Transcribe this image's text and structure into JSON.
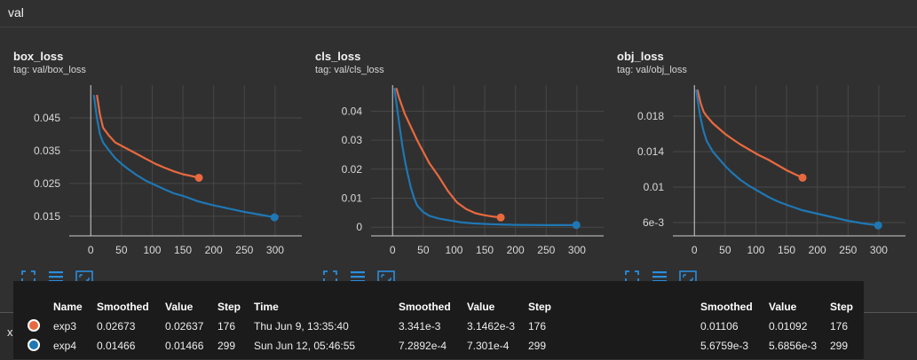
{
  "section": {
    "title": "val"
  },
  "lower_group_label": "x",
  "colors": {
    "exp3": "#e8693f",
    "exp4": "#1f77b4",
    "grid": "#474747",
    "axis": "#cccccc",
    "card_bg": "#303030"
  },
  "charts": [
    {
      "title": "box_loss",
      "tag": "tag: val/box_loss",
      "xlim": [
        -35,
        355
      ],
      "ylim": [
        0.009,
        0.055
      ],
      "yticks": [
        0.015,
        0.025,
        0.035,
        0.045
      ],
      "ytick_labels": [
        "0.015",
        "0.025",
        "0.035",
        "0.045"
      ],
      "xticks": [
        0,
        50,
        100,
        150,
        200,
        250,
        300
      ],
      "xtick_labels": [
        "0",
        "50",
        "100",
        "150",
        "200",
        "250",
        "300"
      ]
    },
    {
      "title": "cls_loss",
      "tag": "tag: val/cls_loss",
      "xlim": [
        -35,
        355
      ],
      "ylim": [
        -0.003,
        0.049
      ],
      "yticks": [
        0,
        0.01,
        0.02,
        0.03,
        0.04
      ],
      "ytick_labels": [
        "0",
        "0.01",
        "0.02",
        "0.03",
        "0.04"
      ],
      "xticks": [
        0,
        50,
        100,
        150,
        200,
        250,
        300
      ],
      "xtick_labels": [
        "0",
        "50",
        "100",
        "150",
        "200",
        "250",
        "300"
      ]
    },
    {
      "title": "obj_loss",
      "tag": "tag: val/obj_loss",
      "xlim": [
        -35,
        355
      ],
      "ylim": [
        0.0045,
        0.0215
      ],
      "yticks": [
        0.006,
        0.01,
        0.014,
        0.018
      ],
      "ytick_labels": [
        "6e-3",
        "0.01",
        "0.014",
        "0.018"
      ],
      "xticks": [
        0,
        50,
        100,
        150,
        200,
        250,
        300
      ],
      "xtick_labels": [
        "0",
        "50",
        "100",
        "150",
        "200",
        "250",
        "300"
      ]
    }
  ],
  "chart_data": [
    {
      "type": "line",
      "title": "box_loss",
      "series": [
        {
          "name": "exp3",
          "x": [
            10,
            15,
            20,
            30,
            40,
            50,
            60,
            75,
            90,
            105,
            120,
            135,
            150,
            165,
            176
          ],
          "y": [
            0.052,
            0.046,
            0.042,
            0.0395,
            0.0375,
            0.0365,
            0.0355,
            0.034,
            0.0325,
            0.031,
            0.0298,
            0.0287,
            0.0278,
            0.0272,
            0.02673
          ]
        },
        {
          "name": "exp4",
          "x": [
            5,
            10,
            15,
            20,
            30,
            40,
            50,
            60,
            75,
            90,
            105,
            120,
            135,
            150,
            175,
            200,
            225,
            250,
            275,
            299
          ],
          "y": [
            0.052,
            0.045,
            0.04,
            0.0375,
            0.035,
            0.0327,
            0.031,
            0.0295,
            0.0275,
            0.0258,
            0.0245,
            0.0232,
            0.022,
            0.0212,
            0.0195,
            0.0183,
            0.0173,
            0.0163,
            0.0155,
            0.01466
          ]
        }
      ]
    },
    {
      "type": "line",
      "title": "cls_loss",
      "series": [
        {
          "name": "exp3",
          "x": [
            6,
            10,
            15,
            20,
            30,
            40,
            50,
            60,
            75,
            90,
            105,
            120,
            135,
            150,
            165,
            176
          ],
          "y": [
            0.048,
            0.045,
            0.042,
            0.039,
            0.0345,
            0.03,
            0.026,
            0.022,
            0.0175,
            0.0125,
            0.0085,
            0.0062,
            0.0048,
            0.0041,
            0.0036,
            0.003341
          ]
        },
        {
          "name": "exp4",
          "x": [
            3,
            8,
            12,
            16,
            20,
            25,
            30,
            35,
            40,
            50,
            60,
            75,
            90,
            110,
            130,
            160,
            200,
            250,
            299
          ],
          "y": [
            0.048,
            0.04,
            0.034,
            0.028,
            0.023,
            0.018,
            0.0135,
            0.01,
            0.0075,
            0.0052,
            0.0039,
            0.003,
            0.0024,
            0.0017,
            0.0013,
            0.001,
            0.0008,
            0.0007,
            0.00072892
          ]
        }
      ]
    },
    {
      "type": "line",
      "title": "obj_loss",
      "series": [
        {
          "name": "exp3",
          "x": [
            5,
            10,
            15,
            20,
            30,
            40,
            50,
            60,
            75,
            90,
            105,
            120,
            135,
            150,
            165,
            176
          ],
          "y": [
            0.021,
            0.0195,
            0.0185,
            0.018,
            0.0172,
            0.0166,
            0.016,
            0.0155,
            0.0148,
            0.0142,
            0.0136,
            0.0131,
            0.0125,
            0.0119,
            0.0114,
            0.01106
          ]
        },
        {
          "name": "exp4",
          "x": [
            3,
            6,
            10,
            15,
            20,
            30,
            40,
            50,
            60,
            75,
            90,
            105,
            120,
            135,
            150,
            175,
            200,
            225,
            250,
            275,
            299
          ],
          "y": [
            0.021,
            0.0195,
            0.0178,
            0.0163,
            0.0152,
            0.014,
            0.0132,
            0.0124,
            0.0117,
            0.0108,
            0.0101,
            0.0095,
            0.0089,
            0.0084,
            0.008,
            0.0074,
            0.007,
            0.0066,
            0.0062,
            0.0059,
            0.0056759
          ]
        }
      ]
    }
  ],
  "tooltip": {
    "headers": [
      "Name",
      "Smoothed",
      "Value",
      "Step",
      "Time",
      "Smoothed",
      "Value",
      "Step",
      "Smoothed",
      "Value",
      "Step"
    ],
    "rows": [
      {
        "name": "exp3",
        "color": "#e8693f",
        "box_smoothed": "0.02673",
        "box_value": "0.02637",
        "box_step": "176",
        "time": "Thu Jun 9, 13:35:40",
        "cls_smoothed": "3.341e-3",
        "cls_value": "3.1462e-3",
        "cls_step": "176",
        "obj_smoothed": "0.01106",
        "obj_value": "0.01092",
        "obj_step": "176"
      },
      {
        "name": "exp4",
        "color": "#1f77b4",
        "box_smoothed": "0.01466",
        "box_value": "0.01466",
        "box_step": "299",
        "time": "Sun Jun 12, 05:46:55",
        "cls_smoothed": "7.2892e-4",
        "cls_value": "7.301e-4",
        "cls_step": "299",
        "obj_smoothed": "5.6759e-3",
        "obj_value": "5.6856e-3",
        "obj_step": "299"
      }
    ]
  },
  "card_icons": [
    "fullscreen-icon",
    "list-icon",
    "fit-domain-icon"
  ]
}
